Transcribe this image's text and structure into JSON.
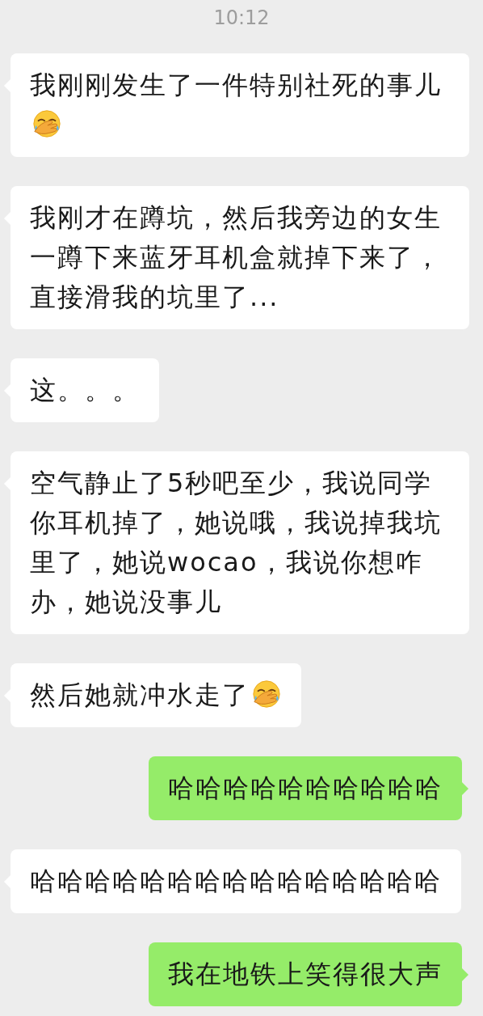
{
  "status": {
    "time": "10:12"
  },
  "messages": [
    {
      "kind": "incoming",
      "text": "我刚刚发生了一件特别社死的事儿",
      "emoji_after": true
    },
    {
      "kind": "incoming",
      "text": "我刚才在蹲坑，然后我旁边的女生一蹲下来蓝牙耳机盒就掉下来了，直接滑我的坑里了...",
      "emoji_after": false
    },
    {
      "kind": "incoming",
      "text": "这。。。",
      "emoji_after": false
    },
    {
      "kind": "incoming",
      "text": "空气静止了5秒吧至少，我说同学你耳机掉了，她说哦，我说掉我坑里了，她说wocao，我说你想咋办，她说没事儿",
      "emoji_after": false
    },
    {
      "kind": "incoming",
      "text": "然后她就冲水走了",
      "emoji_after": true
    },
    {
      "kind": "outgoing",
      "text": "哈哈哈哈哈哈哈哈哈哈",
      "emoji_after": false
    },
    {
      "kind": "incoming",
      "text": "哈哈哈哈哈哈哈哈哈哈哈哈哈哈哈",
      "emoji_after": false
    },
    {
      "kind": "outgoing",
      "text": "我在地铁上笑得很大声",
      "emoji_after": false
    }
  ]
}
